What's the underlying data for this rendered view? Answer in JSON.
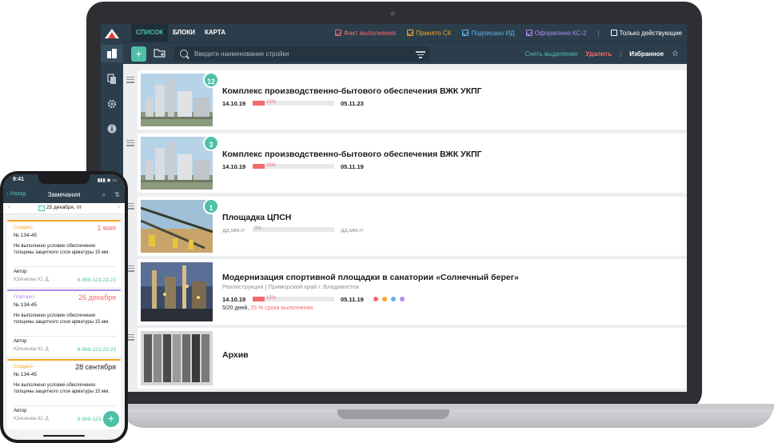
{
  "app": {
    "tabs": [
      {
        "label": "СПИСОК",
        "active": true
      },
      {
        "label": "БЛОКИ",
        "active": false
      },
      {
        "label": "КАРТА",
        "active": false
      }
    ],
    "filters": [
      {
        "label": "Факт выполнения",
        "checked": true,
        "color": "#f26b6b"
      },
      {
        "label": "Принято СК",
        "checked": true,
        "color": "#f5a623"
      },
      {
        "label": "Подписано ИД",
        "checked": true,
        "color": "#5ab4e5"
      },
      {
        "label": "Оформлено КС-2",
        "checked": true,
        "color": "#b48cf0"
      }
    ],
    "only_active_label": "Только действующие",
    "search_placeholder": "Введите наименование стройки",
    "deselect_label": "Снять выделение",
    "delete_label": "Удалить",
    "favorites_label": "Избранное",
    "accent_color": "#4dc0a8"
  },
  "projects": [
    {
      "title": "Комплекс производственно-бытового обеспечения ВЖК УКПГ",
      "badge": "12",
      "start": "14.10.19",
      "end": "05.11.23",
      "progress": 0.15,
      "progress_label": "15%"
    },
    {
      "title": "Комплекс производственно-бытового обеспечения ВЖК УКПГ",
      "badge": "3",
      "start": "14.10.19",
      "end": "05.11.19",
      "progress": 0.15,
      "progress_label": "15%"
    },
    {
      "title": "Площадка ЦПСН",
      "badge": "1",
      "start": "дд.мм.гг",
      "end": "дд.мм.гг",
      "progress": 0,
      "progress_label": "0%"
    },
    {
      "title": "Модернизация спортивной площадки в санатории «Солнечный берег»",
      "type": "Реконструкция",
      "location": "Приморский край г. Владивосток",
      "start": "14.10.19",
      "end": "05.11.19",
      "progress": 0.15,
      "progress_label": "15%",
      "days": "5/20 дней,",
      "deadline": "25 % срока выполнения",
      "dot_colors": [
        "#f26b6b",
        "#f5a623",
        "#5ab4e5",
        "#b48cf0"
      ]
    },
    {
      "title": "Архив"
    }
  ],
  "phone": {
    "time": "9:41",
    "back_label": "Назад",
    "title": "Замечания",
    "date": "25 декабря, пт",
    "cards": [
      {
        "status": "Создано",
        "status_color": "#f5a623",
        "date": "1 мая",
        "date_color": "#f26b6b",
        "number": "№ 134-45",
        "text": "Не выполнено условие обеспечения толщины защитного слоя арматуры 15 мм.",
        "author_label": "Автор",
        "author": "Юленкова Ю. Д.",
        "phone": "8-999-123-23-23"
      },
      {
        "status": "Повторно",
        "status_color": "#b48cf0",
        "date": "26 декабря",
        "date_color": "#f26b6b",
        "number": "№ 134-45",
        "text": "Не выполнено условие обеспечения толщины защитного слоя арматуры 15 мм.",
        "author_label": "Автор",
        "author": "Юленкова Ю. Д.",
        "phone": "8-999-123-23-23"
      },
      {
        "status": "Создано",
        "status_color": "#f5a623",
        "date": "28 сентября",
        "date_color": "#1a1a1a",
        "number": "№ 134-45",
        "text": "Не выполнено условие обеспечения толщины защитного слоя арматуры 15 мм.",
        "author_label": "Автор",
        "author": "Юленкова Ю. Д.",
        "phone": "8-999-123-23-23"
      }
    ]
  }
}
